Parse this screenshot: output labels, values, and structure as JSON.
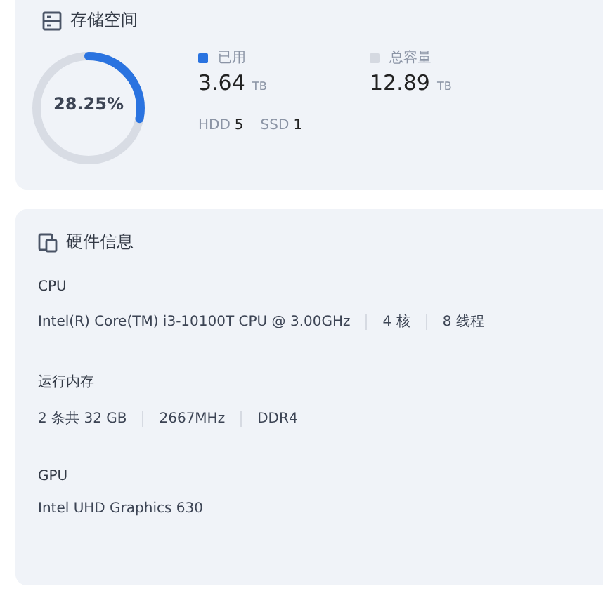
{
  "storage": {
    "title": "存储空间",
    "percent": "28.25%",
    "level": 0.2825,
    "legend": [
      {
        "label": "已用",
        "value": "3.64",
        "unit": "TB",
        "color": "#2a73e0"
      },
      {
        "label": "总容量",
        "value": "12.89",
        "unit": "TB",
        "color": "#d5d9e1"
      }
    ],
    "disks": [
      {
        "type": "HDD",
        "count": "5"
      },
      {
        "type": "SSD",
        "count": "1"
      }
    ]
  },
  "hardware": {
    "title": "硬件信息",
    "sections": [
      {
        "label": "CPU",
        "items": [
          "Intel(R) Core(TM) i3-10100T CPU @ 3.00GHz",
          "4 核",
          "8 线程"
        ]
      },
      {
        "label": "运行内存",
        "items": [
          "2 条共 32 GB",
          "2667MHz",
          "DDR4"
        ]
      },
      {
        "label": "GPU",
        "items": [
          "Intel UHD Graphics 630"
        ]
      }
    ]
  }
}
